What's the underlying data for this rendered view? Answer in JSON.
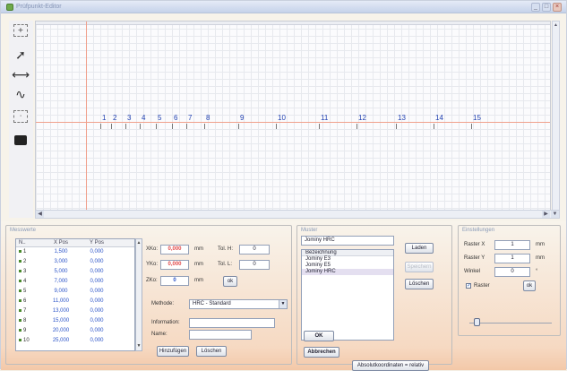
{
  "window": {
    "title": "Prüfpunkt-Editor",
    "min": "_",
    "max": "□",
    "close": "×"
  },
  "toolbar": {
    "tool_icons": [
      "cursor-icon",
      "arrow-icon",
      "horizontal-arrows-icon",
      "wave-icon",
      "dotted-box-icon",
      "camera-icon"
    ]
  },
  "canvas": {
    "points": [
      "1",
      "2",
      "3",
      "4",
      "5",
      "6",
      "7",
      "8",
      "9",
      "10",
      "11",
      "12",
      "13",
      "14",
      "15"
    ],
    "axis_color": "#f0a08c",
    "label_color": "#1f3fb0"
  },
  "messwerte": {
    "title": "Messwerte",
    "columns": [
      "N..",
      "X Pos",
      "Y Pos"
    ],
    "rows": [
      {
        "n": "1",
        "x": "1,500",
        "y": "0,000"
      },
      {
        "n": "2",
        "x": "3,000",
        "y": "0,000"
      },
      {
        "n": "3",
        "x": "5,000",
        "y": "0,000"
      },
      {
        "n": "4",
        "x": "7,000",
        "y": "0,000"
      },
      {
        "n": "5",
        "x": "9,000",
        "y": "0,000"
      },
      {
        "n": "6",
        "x": "11,000",
        "y": "0,000"
      },
      {
        "n": "7",
        "x": "13,000",
        "y": "0,000"
      },
      {
        "n": "8",
        "x": "15,000",
        "y": "0,000"
      },
      {
        "n": "9",
        "x": "20,000",
        "y": "0,000"
      },
      {
        "n": "10",
        "x": "25,000",
        "y": "0,000"
      }
    ]
  },
  "coords": {
    "xko_label": "XKo:",
    "xko_value": "0,000",
    "xko_unit": "mm",
    "yko_label": "YKo:",
    "yko_value": "0,000",
    "yko_unit": "mm",
    "zko_label": "ZKo:",
    "zko_value": "0",
    "zko_unit": "mm",
    "tolh_label": "Tol. H:",
    "tolh_value": "0",
    "toll_label": "Tol. L:",
    "toll_value": "0",
    "ok_label": "ok"
  },
  "method": {
    "label": "Methode:",
    "value": "HRC - Standard",
    "information_label": "Information:",
    "information_value": "",
    "name_label": "Name:",
    "name_value": ""
  },
  "actions": {
    "add": "Hinzufügen",
    "delete": "Löschen"
  },
  "muster": {
    "title": "Muster",
    "name_value": "Jominy HRC",
    "list_header": "Bezeichnung",
    "items": [
      "Jominy E3",
      "Jominy E5",
      "Jominy HRC"
    ],
    "selected_index": 2,
    "load": "Laden",
    "save": "Speichern",
    "delete": "Löschen"
  },
  "dialog": {
    "ok": "OK",
    "cancel": "Abbrechen",
    "absolute": "Absolutkoordinaten = relativ"
  },
  "settings": {
    "title": "Einstellungen",
    "raster_x_label": "Raster X",
    "raster_x_value": "1",
    "raster_x_unit": "mm",
    "raster_y_label": "Raster Y",
    "raster_y_value": "1",
    "raster_y_unit": "mm",
    "winkel_label": "Winkel",
    "winkel_value": "0",
    "winkel_unit": "°",
    "raster_check_label": "Raster",
    "raster_checked": true,
    "ok_label": "ok",
    "slider_level": 0.05
  }
}
